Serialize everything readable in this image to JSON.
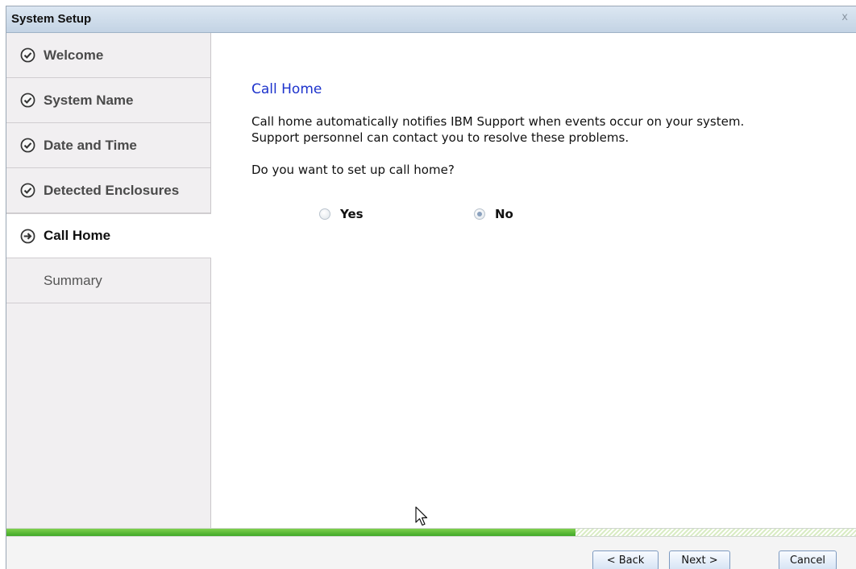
{
  "window": {
    "title": "System Setup",
    "close_glyph": "x"
  },
  "sidebar": {
    "steps": [
      {
        "label": "Welcome",
        "state": "done",
        "icon": "check-circle-icon"
      },
      {
        "label": "System Name",
        "state": "done",
        "icon": "check-circle-icon"
      },
      {
        "label": "Date and Time",
        "state": "done",
        "icon": "check-circle-icon"
      },
      {
        "label": "Detected Enclosures",
        "state": "done",
        "icon": "check-circle-icon"
      },
      {
        "label": "Call Home",
        "state": "current",
        "icon": "arrow-circle-icon"
      },
      {
        "label": "Summary",
        "state": "pending"
      }
    ]
  },
  "main": {
    "title": "Call Home",
    "description_line1": "Call home automatically notifies IBM Support when events occur on your system.",
    "description_line2": "Support personnel can contact you to resolve these problems.",
    "question": "Do you want to set up call home?",
    "options": [
      {
        "label": "Yes",
        "selected": false
      },
      {
        "label": "No",
        "selected": true
      }
    ]
  },
  "progress": {
    "fraction": 0.67,
    "color": "#4caf2e"
  },
  "footer": {
    "back_label": "< Back",
    "next_label": "Next >",
    "cancel_label": "Cancel"
  }
}
